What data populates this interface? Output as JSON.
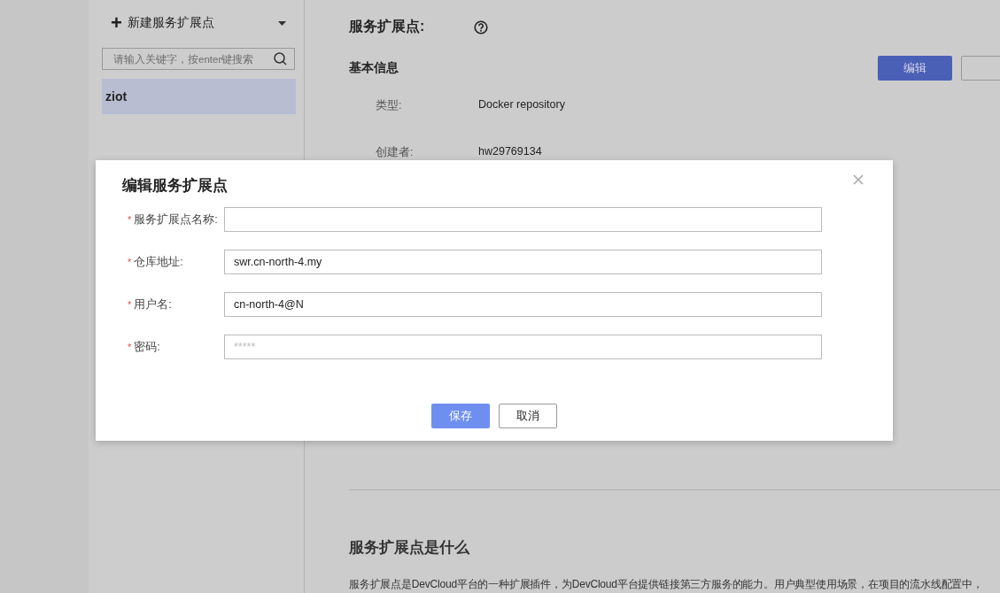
{
  "sidebar": {
    "new_button": {
      "icon": "+",
      "label": "新建服务扩展点"
    },
    "search": {
      "placeholder": "请输入关键字，按enter键搜索"
    },
    "items": [
      {
        "label": "ziot",
        "selected": true
      }
    ]
  },
  "detail": {
    "title": "服务扩展点:",
    "section": "基本信息",
    "edit_button": "编辑",
    "rows": [
      {
        "label": "类型:",
        "value": "Docker repository"
      },
      {
        "label": "创建者:",
        "value": "hw29769134"
      }
    ],
    "about_title": "服务扩展点是什么",
    "about_text": "服务扩展点是DevCloud平台的一种扩展插件，为DevCloud平台提供链接第三方服务的能力。用户典型使用场景，在项目的流水线配置中，"
  },
  "dialog": {
    "title": "编辑服务扩展点",
    "fields": [
      {
        "mark": "*",
        "label": "服务扩展点名称:"
      },
      {
        "mark": "*",
        "label": "仓库地址:",
        "value": "swr.cn-north-4.my"
      },
      {
        "mark": "*",
        "label": "用户名:",
        "value": "cn-north-4@N"
      },
      {
        "mark": "*",
        "label": "密码:",
        "placeholder": "*****"
      }
    ],
    "save": "保存",
    "cancel": "取消"
  }
}
